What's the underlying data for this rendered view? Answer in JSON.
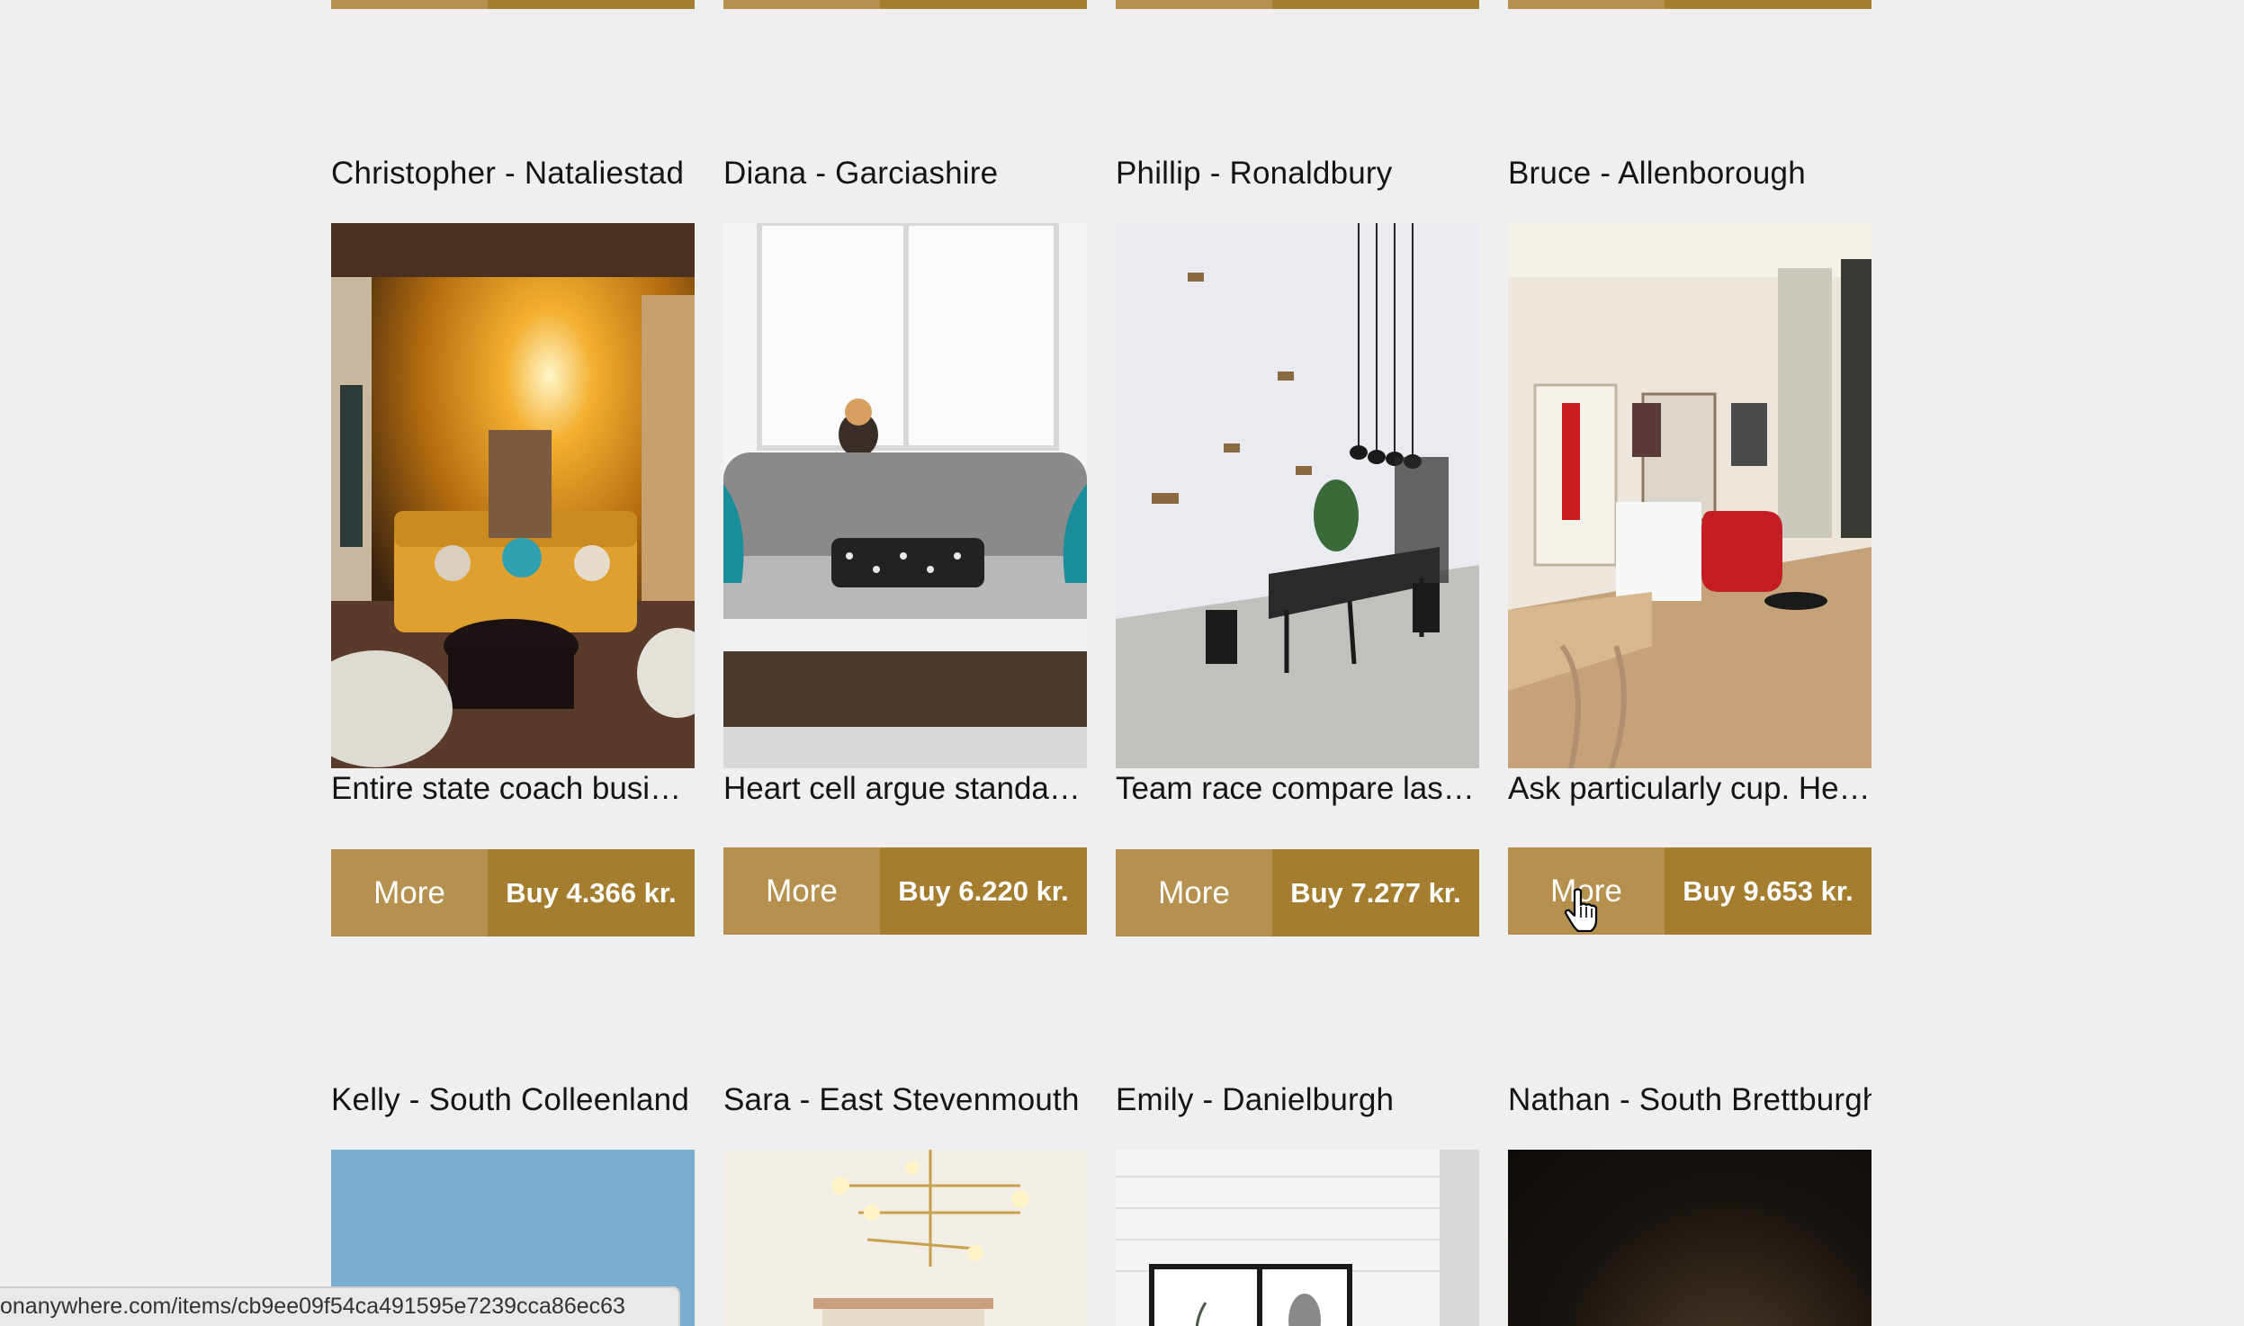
{
  "listings": [
    {
      "title": "Christopher - Nataliestad",
      "description": "Entire state coach busin…",
      "more_label": "More",
      "buy_label": "Buy 4.366 kr."
    },
    {
      "title": "Diana - Garciashire",
      "description": "Heart cell argue standar…",
      "more_label": "More",
      "buy_label": "Buy 6.220 kr."
    },
    {
      "title": "Phillip - Ronaldbury",
      "description": "Team race compare last…",
      "more_label": "More",
      "buy_label": "Buy 7.277 kr."
    },
    {
      "title": "Bruce - Allenborough",
      "description": "Ask particularly cup. Her…",
      "more_label": "More",
      "buy_label": "Buy 9.653 kr."
    }
  ],
  "next_listings": [
    {
      "title": "Kelly - South Colleenland"
    },
    {
      "title": "Sara - East Stevenmouth"
    },
    {
      "title": "Emily - Danielburgh"
    },
    {
      "title": "Nathan - South Brettburgh"
    }
  ],
  "status_bar": {
    "url": "onanywhere.com/items/cb9ee09f54ca491595e7239cca86ec63"
  },
  "colors": {
    "more_button": "#b5904e",
    "buy_button": "#a57d2e",
    "background": "#efefef"
  }
}
